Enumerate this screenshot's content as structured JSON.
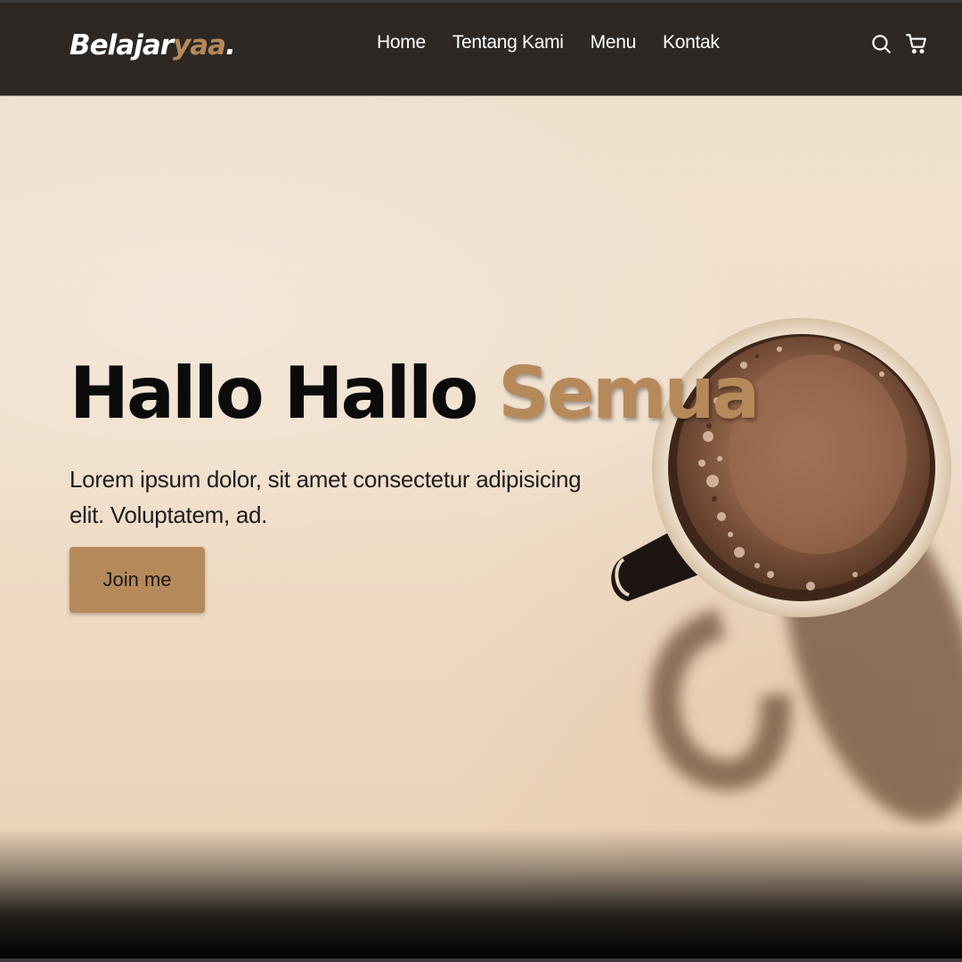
{
  "brand": {
    "name_main": "Belajar",
    "name_accent": "yaa",
    "name_dot": ".",
    "accent_color": "#b6895b",
    "navbar_color": "#2d2824"
  },
  "nav": {
    "items": [
      {
        "label": "Home"
      },
      {
        "label": "Tentang Kami"
      },
      {
        "label": "Menu"
      },
      {
        "label": "Kontak"
      }
    ],
    "icons": [
      "search-icon",
      "shopping-cart-icon"
    ]
  },
  "hero": {
    "title_main": "Hallo Hallo",
    "title_accent": "Semua",
    "text": "Lorem ipsum dolor, sit amet consectetur adipisicing elit. Voluptatem, ad.",
    "button_label": "Join me"
  }
}
